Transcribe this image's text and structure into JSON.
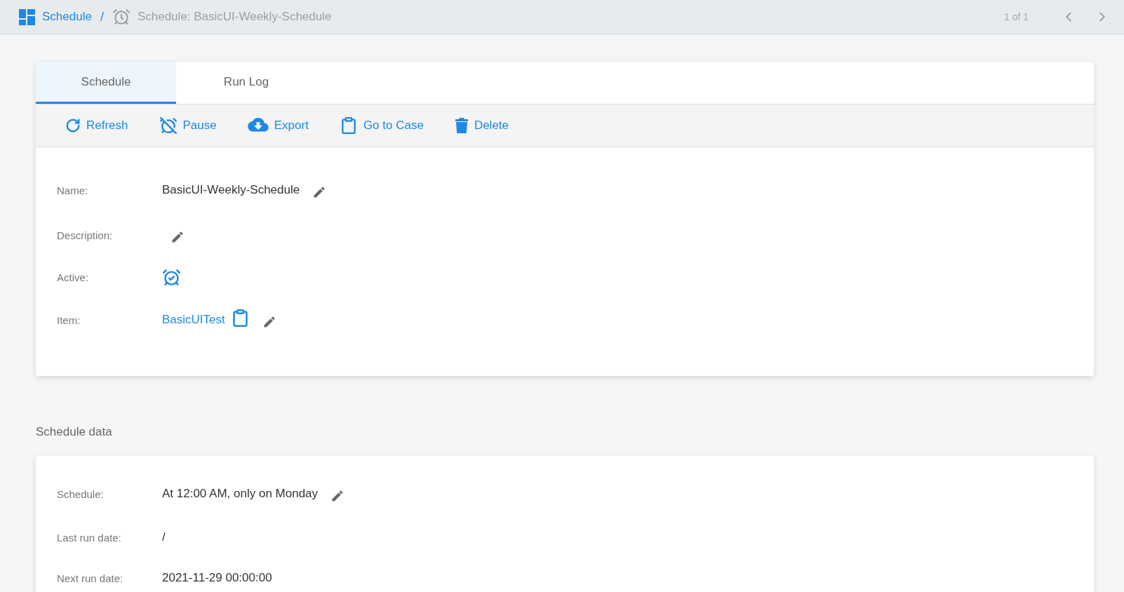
{
  "breadcrumb": {
    "root": "Schedule",
    "separator": "/",
    "current": "Schedule: BasicUI-Weekly-Schedule"
  },
  "pager": {
    "text": "1 of 1"
  },
  "tabs": [
    {
      "label": "Schedule",
      "selected": true
    },
    {
      "label": "Run Log",
      "selected": false
    }
  ],
  "toolbar": [
    "Refresh",
    "Pause",
    "Export",
    "Go to Case",
    "Delete"
  ],
  "details": [
    {
      "label": "Name:",
      "kind": "text",
      "value": "BasicUI-Weekly-Schedule",
      "editable": true
    },
    {
      "label": "Description:",
      "kind": "text",
      "editable": true
    },
    {
      "label": "Active:",
      "kind": "active",
      "active": true
    },
    {
      "label": "Item:",
      "kind": "link",
      "value": "BasicUITest",
      "editable": true
    }
  ],
  "schedule_data": {
    "title": "Schedule data",
    "fields": [
      {
        "label": "Schedule:",
        "kind": "text",
        "value": "At 12:00 AM, only on Monday",
        "editable": true
      },
      {
        "label": "Last run date:",
        "kind": "text",
        "value": "/",
        "editable": false
      },
      {
        "label": "Next run date:",
        "kind": "text",
        "value": "2021-11-29 00:00:00",
        "editable": false
      }
    ]
  }
}
